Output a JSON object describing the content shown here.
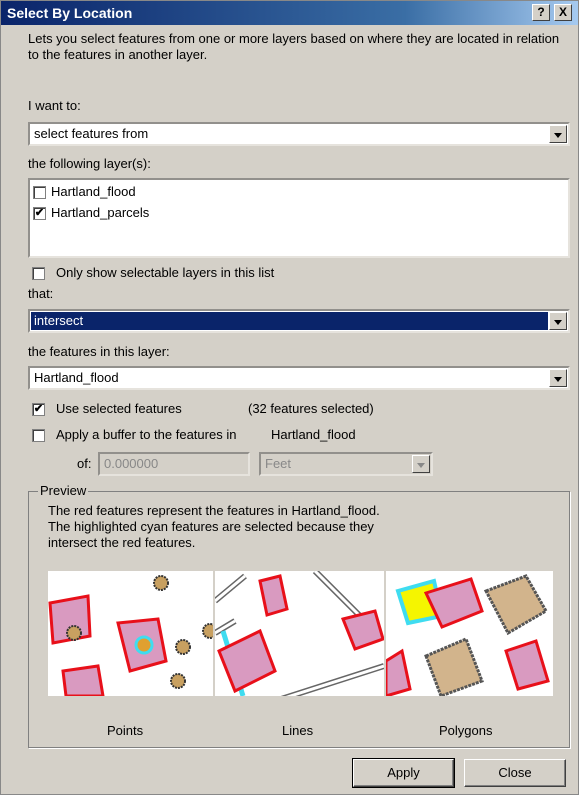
{
  "window": {
    "title": "Select By Location",
    "help_label": "?",
    "close_label": "X"
  },
  "description": "Lets you select features from one or more layers based on where they are located in relation to the features in another layer.",
  "want_to": {
    "label": "I want to:",
    "value": "select features from"
  },
  "layers": {
    "label": "the following layer(s):",
    "items": [
      {
        "label": "Hartland_flood",
        "checked": false
      },
      {
        "label": "Hartland_parcels",
        "checked": true
      }
    ]
  },
  "only_selectable": {
    "label": "Only show selectable layers in this list",
    "checked": false
  },
  "that": {
    "label": "that:",
    "value": "intersect"
  },
  "features_layer": {
    "label": "the features in this layer:",
    "value": "Hartland_flood"
  },
  "use_selected": {
    "label": "Use selected features",
    "checked": true,
    "count_text": "(32 features selected)"
  },
  "buffer": {
    "label": "Apply a buffer to the features in",
    "layer": "Hartland_flood",
    "checked": false,
    "of_label": "of:",
    "distance": "0.000000",
    "unit": "Feet"
  },
  "preview": {
    "label": "Preview",
    "text_line1": "The red features represent the features in Hartland_flood.",
    "text_line2": "The highlighted cyan features are selected because they",
    "text_line3": "intersect the red features.",
    "captions": [
      "Points",
      "Lines",
      "Polygons"
    ]
  },
  "buttons": {
    "apply": "Apply",
    "close": "Close"
  },
  "colors": {
    "title_bar": "#0a246a",
    "selection": "#0a246a",
    "flood_red": "#e8101a",
    "parcel_pink": "#d99ac0",
    "cyan": "#3fdcf0",
    "tan": "#d2b48c",
    "yellow": "#f5f500"
  }
}
